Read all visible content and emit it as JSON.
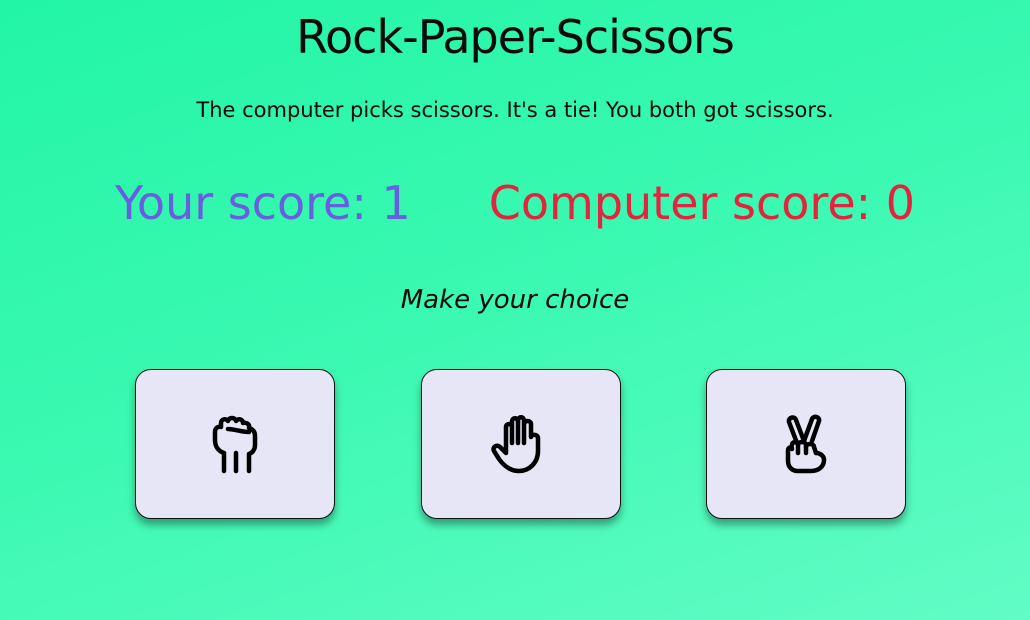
{
  "title": "Rock-Paper-Scissors",
  "result_message": "The computer picks scissors. It's a tie! You both got scissors.",
  "scores": {
    "player_label": "Your score: 1",
    "computer_label": "Computer score: 0",
    "player_value": 1,
    "computer_value": 0,
    "player_color": "#6a5ee0",
    "computer_color": "#e2243f"
  },
  "prompt": "Make your choice",
  "choices": [
    {
      "id": "rock",
      "icon": "fist-icon"
    },
    {
      "id": "paper",
      "icon": "open-hand-icon"
    },
    {
      "id": "scissors",
      "icon": "peace-hand-icon"
    }
  ],
  "colors": {
    "background_start": "#22f5a6",
    "background_end": "#62fcc6",
    "button_background": "#e6e6f7"
  }
}
